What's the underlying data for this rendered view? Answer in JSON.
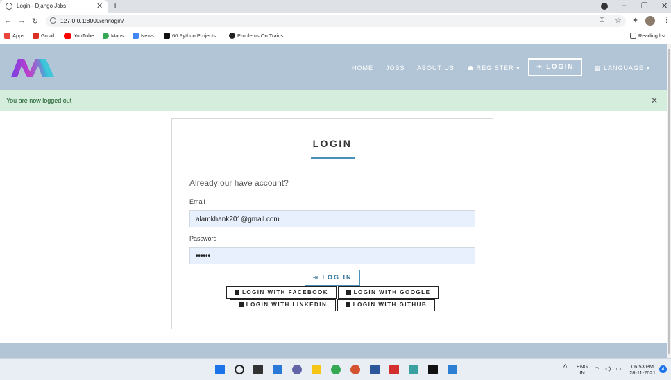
{
  "browser": {
    "tab_title": "Login - Django Jobs",
    "url": "127.0.0.1:8000/en/login/",
    "bookmarks": [
      "Apps",
      "Gmail",
      "YouTube",
      "Maps",
      "News",
      "60 Python Projects...",
      "Problems On Trains..."
    ],
    "reading_list": "Reading list"
  },
  "site": {
    "nav": {
      "home": "HOME",
      "jobs": "JOBS",
      "about": "ABOUT US",
      "register": "REGISTER",
      "login": "LOGIN",
      "language": "LANGUAGE"
    },
    "alert": "You are now logged out"
  },
  "login": {
    "title": "LOGIN",
    "subtitle": "Already our have account?",
    "email_label": "Email",
    "email_value": "alamkhank201@gmail.com",
    "password_label": "Password",
    "password_value": "••••••",
    "submit": "LOG IN",
    "social": {
      "facebook": "LOGIN WITH FACEBOOK",
      "google": "LOGIN WITH GOOGLE",
      "linkedin": "LOGIN WITH LINKEDIN",
      "github": "LOGIN WITH GITHUB"
    }
  },
  "taskbar": {
    "lang_top": "ENG",
    "lang_bottom": "IN",
    "time": "06:53 PM",
    "date": "28-11-2021",
    "notifications": "4"
  },
  "colors": {
    "navbar": "#b1c5d6",
    "alert_bg": "#d4eddc",
    "accent": "#4a90b8"
  }
}
